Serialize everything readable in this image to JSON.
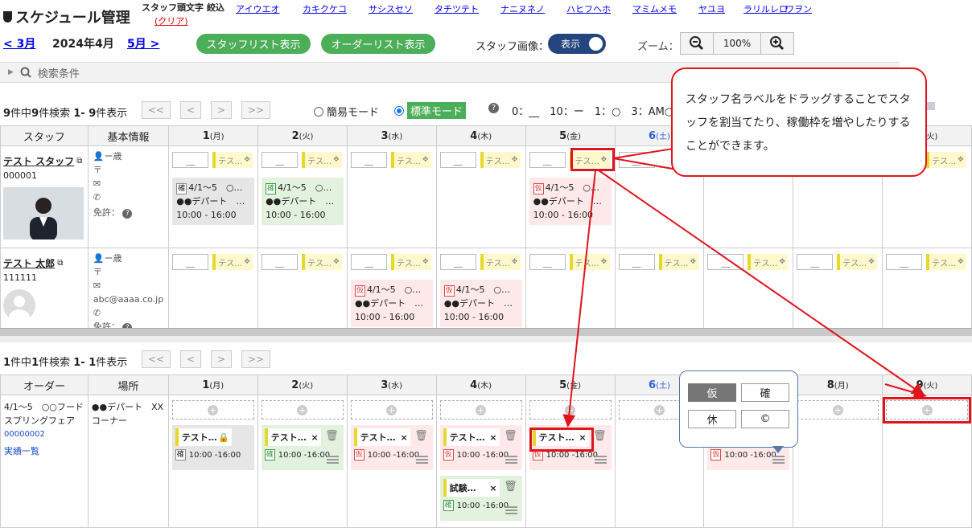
{
  "header": {
    "title": "スケジュール管理",
    "initial_filter_label": "スタッフ頭文字 絞込",
    "clear_label": "(クリア)",
    "kana_groups": [
      "アイウエオ",
      "カキクケコ",
      "サシスセソ",
      "タチツテト",
      "ナニヌネノ",
      "ハヒフヘホ",
      "マミムメモ",
      "ヤユヨ",
      "ラリルレロ",
      "ワヲン"
    ],
    "prev_month": "< 3月",
    "current_month": "2024年4月",
    "next_month": "5月 >",
    "staff_list_button": "スタッフリスト表示",
    "order_list_button": "オーダーリスト表示",
    "staff_image_label": "スタッフ画像：",
    "staff_image_toggle": "表示",
    "zoom_label": "ズーム：",
    "zoom_value": "100%"
  },
  "search": {
    "label": "検索条件"
  },
  "staff_section": {
    "summary_total": "9",
    "summary_text1": "件中",
    "summary_found": "9",
    "summary_text2": "件検索",
    "summary_range": "1- 9",
    "summary_text3": "件表示",
    "pager": [
      "<<",
      "<",
      ">",
      ">>"
    ],
    "mode_simple": "簡易モード",
    "mode_standard": "標準モード",
    "legend_text": "0：__　10：ー　1：○　3：AM○",
    "columns": {
      "staff": "スタッフ",
      "info": "基本情報"
    },
    "days": [
      {
        "num": "1",
        "wd": "(月)",
        "sat": false
      },
      {
        "num": "2",
        "wd": "(火)",
        "sat": false
      },
      {
        "num": "3",
        "wd": "(水)",
        "sat": false
      },
      {
        "num": "4",
        "wd": "(木)",
        "sat": false
      },
      {
        "num": "5",
        "wd": "(金)",
        "sat": false
      },
      {
        "num": "6",
        "wd": "(土)",
        "sat": true
      },
      {
        "num": "7",
        "wd": "(日)",
        "sat": false
      },
      {
        "num": "8",
        "wd": "(月)",
        "sat": false
      },
      {
        "num": "9",
        "wd": "(火)",
        "sat": false
      }
    ],
    "slot_value": "＿",
    "slot_label": "テス…",
    "staff": [
      {
        "name": "テスト スタッフ",
        "id": "000001",
        "age": "ー歳",
        "email": "",
        "license": "免許："
      },
      {
        "name": "テスト 太郎",
        "id": "111111",
        "age": "ー歳",
        "email": "abc@aaaa.co.jp",
        "license": "免許："
      }
    ],
    "card_period": "4/1～5",
    "card_extra": "○…",
    "card_place": "●●デパート",
    "card_more": "…",
    "card_time": "10:00 - 16:00",
    "tag_confirmed": "確",
    "tag_tentative": "仮"
  },
  "order_section": {
    "summary_total": "1",
    "summary_text1": "件中",
    "summary_found": "1",
    "summary_text2": "件検索",
    "summary_range": "1- 1",
    "summary_text3": "件表示",
    "columns": {
      "order": "オーダー",
      "place": "場所"
    },
    "order": {
      "title": "4/1～5　○○フード スプリングフェア",
      "id": "00000002",
      "results_link": "実績一覧",
      "place": "●●デパート　XXコーナー"
    },
    "card_label": "テスト…",
    "card_label2": "試験…",
    "card_time": "10:00 -16:00",
    "close_glyph": "×"
  },
  "callout": {
    "text": "スタッフ名ラベルをドラッグすることでスタッフを割当てたり、稼働枠を増やしたりすることができます。"
  },
  "popup": {
    "buttons": [
      "仮",
      "確",
      "休",
      "©"
    ]
  },
  "colors": {
    "green_button": "#4cae58",
    "toggle": "#24467f",
    "annotation_red": "#e0141c",
    "saturday": "#2a5fd6"
  }
}
